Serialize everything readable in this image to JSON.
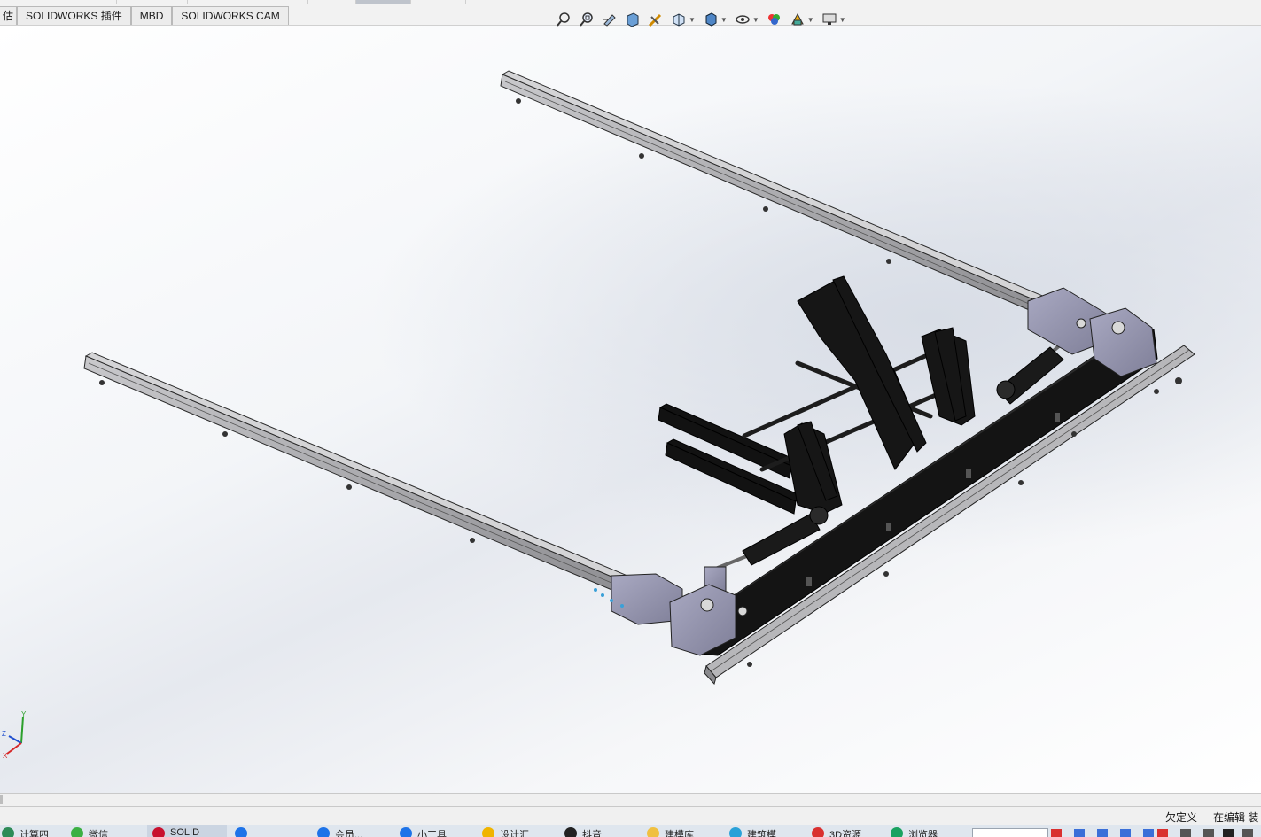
{
  "tabs": {
    "cut_label": "估",
    "items": [
      "SOLIDWORKS 插件",
      "MBD",
      "SOLIDWORKS CAM"
    ]
  },
  "hud": {
    "buttons": [
      {
        "name": "zoom-to-fit-icon"
      },
      {
        "name": "zoom-to-area-icon"
      },
      {
        "name": "previous-view-icon"
      },
      {
        "name": "section-view-icon"
      },
      {
        "name": "dynamic-annotation-icon"
      },
      {
        "name": "view-orientation-icon",
        "dropdown": true
      },
      {
        "name": "display-style-icon",
        "dropdown": true
      },
      {
        "name": "hide-show-items-icon",
        "dropdown": true
      },
      {
        "name": "edit-appearance-icon"
      },
      {
        "name": "apply-scene-icon",
        "dropdown": true
      },
      {
        "name": "view-settings-icon",
        "dropdown": true
      }
    ]
  },
  "triad": {
    "x": "X",
    "y": "Y",
    "z": "Z"
  },
  "status": {
    "underdefined": "欠定义",
    "editing": "在编辑 装"
  },
  "taskbar": {
    "items": [
      {
        "label": "计算四",
        "color": "#2e8b57"
      },
      {
        "label": "微信",
        "color": "#3cb043"
      },
      {
        "label": "SOLID",
        "color": "#c8102e"
      },
      {
        "label": "",
        "color": "#1e73e8"
      },
      {
        "label": "会员...",
        "color": "#1e73e8"
      },
      {
        "label": "小工具",
        "color": "#1e73e8"
      },
      {
        "label": "设计汇",
        "color": "#f0b400"
      },
      {
        "label": "抖音",
        "color": "#222222"
      },
      {
        "label": "建模库",
        "color": "#f0c040"
      },
      {
        "label": "建筑模",
        "color": "#2aa1d8"
      },
      {
        "label": "3D资源",
        "color": "#d9302f"
      },
      {
        "label": "浏览器",
        "color": "#1aa260"
      }
    ]
  },
  "colors": {
    "frame": "#121212",
    "rail": "#8e8e92",
    "bracket": "#8d8da8",
    "viewport_shade": "#d8dde6"
  }
}
